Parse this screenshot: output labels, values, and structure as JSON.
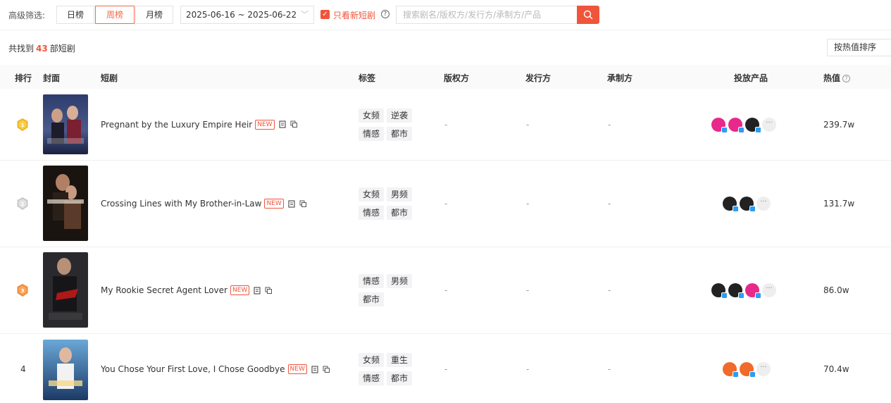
{
  "filters": {
    "label": "高级筛选:",
    "periods": [
      "日榜",
      "周榜",
      "月榜"
    ],
    "active_period": "周榜",
    "date_range": "2025-06-16 ~ 2025-06-22",
    "new_only_label": "只看新短剧",
    "search_placeholder": "搜索剧名/版权方/发行方/承制方/产品"
  },
  "summary": {
    "prefix": "共找到",
    "count": "43",
    "suffix": "部短剧",
    "sort_label": "按热值排序"
  },
  "columns": {
    "rank": "排行",
    "cover": "封面",
    "drama": "短剧",
    "tags": "标签",
    "copyright": "版权方",
    "publisher": "发行方",
    "producer": "承制方",
    "products": "投放产品",
    "heat": "热值"
  },
  "colors": {
    "accent": "#f0553b",
    "gold": "#f2b21f",
    "silver": "#c9c9c9",
    "bronze": "#f08a3a"
  },
  "rows": [
    {
      "rank": "1",
      "medal": "gold",
      "title": "Pregnant by the Luxury Empire Heir",
      "is_new": true,
      "new_label": "NEW",
      "tags": [
        "女频",
        "逆袭",
        "情感",
        "都市"
      ],
      "copyright": "-",
      "publisher": "-",
      "producer": "-",
      "product_icons": [
        "pink-app-icon",
        "pink-app-icon",
        "dark-app-icon"
      ],
      "heat": "239.7w"
    },
    {
      "rank": "2",
      "medal": "silver",
      "title": "Crossing Lines with My Brother-in-Law",
      "is_new": true,
      "new_label": "NEW",
      "tags": [
        "女频",
        "男频",
        "情感",
        "都市"
      ],
      "copyright": "-",
      "publisher": "-",
      "producer": "-",
      "product_icons": [
        "dark-app-icon",
        "dark-app-icon"
      ],
      "heat": "131.7w"
    },
    {
      "rank": "3",
      "medal": "bronze",
      "title": "My Rookie Secret Agent Lover",
      "is_new": true,
      "new_label": "NEW",
      "tags": [
        "情感",
        "男频",
        "都市"
      ],
      "copyright": "-",
      "publisher": "-",
      "producer": "-",
      "product_icons": [
        "dark-app-icon",
        "dark-app-icon",
        "pink-app-icon"
      ],
      "heat": "86.0w"
    },
    {
      "rank": "4",
      "medal": "",
      "title": "You Chose Your First Love, I Chose Goodbye",
      "is_new": true,
      "new_label": "NEW",
      "tags": [
        "女频",
        "重生",
        "情感",
        "都市"
      ],
      "copyright": "-",
      "publisher": "-",
      "producer": "-",
      "product_icons": [
        "orange-app-icon",
        "orange-app-icon"
      ],
      "heat": "70.4w"
    }
  ],
  "more_label": "···"
}
